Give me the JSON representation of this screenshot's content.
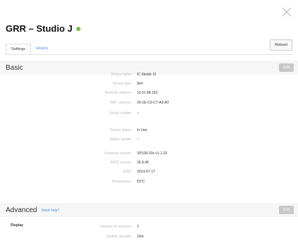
{
  "dialog": {
    "title": "GRR – Studio J",
    "status_color": "#7ac143",
    "close_icon": "close-icon"
  },
  "tabs": [
    {
      "label": "Settings",
      "active": true
    },
    {
      "label": "History",
      "active": false
    }
  ],
  "toolbar": {
    "reboot_label": "Reboot"
  },
  "basic": {
    "title": "Basic",
    "edit_label": "Edit",
    "rows": [
      {
        "label": "Device name",
        "value": "IC Studio J1"
      },
      {
        "label": "Device type",
        "value": "8x4"
      },
      {
        "label": "Network address",
        "value": "10.51.68.153"
      },
      {
        "label": "MAC address",
        "value": "00-1E-C0-C7-A9-A0"
      },
      {
        "label": "Serial number",
        "value": "--"
      },
      {
        "label": "Device status",
        "value": "In Use"
      },
      {
        "label": "Status update",
        "value": "--"
      },
      {
        "label": "Firmware version",
        "value": "SP106-20x v1.1.23"
      },
      {
        "label": "BIOS version",
        "value": "26.8.45"
      },
      {
        "label": "EDID",
        "value": "2014-07-17"
      },
      {
        "label": "Temperature",
        "value": "52ºC"
      }
    ]
  },
  "advanced": {
    "title": "Advanced",
    "help_label": "Need help?",
    "edit_label": "Edit",
    "display_label": "Display",
    "rows": [
      {
        "label": "Number of monitors",
        "value": "2"
      },
      {
        "label": "System standby",
        "value": "10m"
      }
    ]
  }
}
